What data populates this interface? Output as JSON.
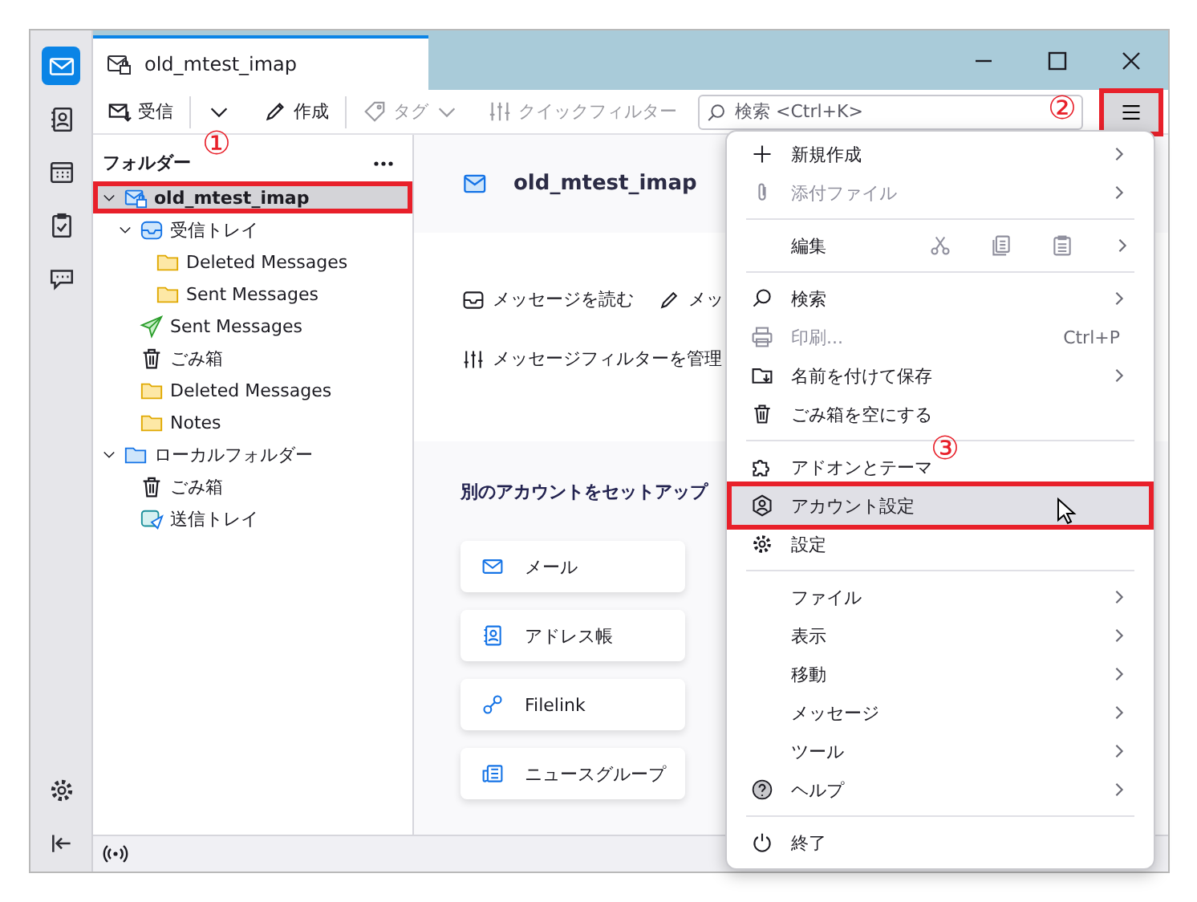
{
  "window": {
    "tab_title": "old_mtest_imap"
  },
  "spaces": [
    {
      "kind": "mail",
      "selected": true
    },
    {
      "kind": "addressbook",
      "selected": false
    },
    {
      "kind": "calendar",
      "selected": false
    },
    {
      "kind": "tasks",
      "selected": false
    },
    {
      "kind": "chat",
      "selected": false
    }
  ],
  "toolbar": {
    "get_messages": "受信",
    "write": "作成",
    "tag": {
      "label": "タグ",
      "disabled": true
    },
    "quick_filter": {
      "label": "クイックフィルター",
      "disabled": true
    },
    "search": {
      "placeholder": "検索 <Ctrl+K>"
    },
    "menu_button": {
      "highlighted": true,
      "callout": "②"
    }
  },
  "folder_pane": {
    "header": "フォルダー",
    "folders": [
      {
        "name": "old_mtest_imap",
        "kind": "account",
        "expanded": true,
        "selected": true,
        "highlighted": true,
        "callout": "①",
        "children": [
          {
            "name": "受信トレイ",
            "kind": "inbox",
            "expanded": true,
            "selected": false,
            "highlighted": false,
            "children": [
              {
                "name": "Deleted Messages",
                "kind": "folder",
                "selected": false,
                "highlighted": false
              },
              {
                "name": "Sent Messages",
                "kind": "folder",
                "selected": false,
                "highlighted": false
              }
            ]
          },
          {
            "name": "Sent Messages",
            "kind": "sent",
            "selected": false,
            "highlighted": false
          },
          {
            "name": "ごみ箱",
            "kind": "trash",
            "selected": false,
            "highlighted": false
          },
          {
            "name": "Deleted Messages",
            "kind": "folder",
            "selected": false,
            "highlighted": false
          },
          {
            "name": "Notes",
            "kind": "folder",
            "selected": false,
            "highlighted": false
          }
        ]
      },
      {
        "name": "ローカルフォルダー",
        "kind": "local",
        "expanded": true,
        "selected": false,
        "highlighted": false,
        "children": [
          {
            "name": "ごみ箱",
            "kind": "trash",
            "selected": false,
            "highlighted": false
          },
          {
            "name": "送信トレイ",
            "kind": "outbox",
            "selected": false,
            "highlighted": false
          }
        ]
      }
    ]
  },
  "account_hub": {
    "title": "old_mtest_imap",
    "actions": [
      {
        "kind": "read",
        "label": "メッセージを読む"
      },
      {
        "kind": "write",
        "label": "メッ"
      },
      {
        "kind": "filters",
        "label": "メッセージフィルターを管理"
      }
    ],
    "setup_title": "別のアカウントをセットアップ",
    "setup_options": [
      {
        "kind": "mail",
        "label": "メール"
      },
      {
        "kind": "addressbook",
        "label": "アドレス帳"
      },
      {
        "kind": "link",
        "label": "Filelink"
      },
      {
        "kind": "news",
        "label": "ニュースグループ"
      }
    ]
  },
  "app_menu": [
    {
      "kind": "new",
      "label": "新規作成",
      "submenu": true,
      "disabled": false,
      "selected": false,
      "highlighted": false
    },
    {
      "kind": "attachments",
      "label": "添付ファイル",
      "submenu": true,
      "disabled": true,
      "selected": false,
      "highlighted": false
    },
    {
      "kind": "separator"
    },
    {
      "kind": "edit",
      "label": "編集",
      "submenu": true
    },
    {
      "kind": "separator"
    },
    {
      "kind": "search",
      "label": "検索",
      "submenu": true,
      "disabled": false,
      "selected": false,
      "highlighted": false
    },
    {
      "kind": "print",
      "label": "印刷...",
      "shortcut": "Ctrl+P",
      "submenu": false,
      "disabled": true,
      "selected": false,
      "highlighted": false
    },
    {
      "kind": "save_as",
      "label": "名前を付けて保存",
      "submenu": true,
      "disabled": false,
      "selected": false,
      "highlighted": false
    },
    {
      "kind": "empty_trash",
      "label": "ごみ箱を空にする",
      "submenu": false,
      "disabled": false,
      "selected": false,
      "highlighted": false
    },
    {
      "kind": "separator"
    },
    {
      "kind": "addons",
      "label": "アドオンとテーマ",
      "submenu": false,
      "disabled": false,
      "selected": false,
      "highlighted": false
    },
    {
      "kind": "account_settings",
      "label": "アカウント設定",
      "submenu": false,
      "disabled": false,
      "selected": true,
      "highlighted": true,
      "callout": "③"
    },
    {
      "kind": "settings",
      "label": "設定",
      "submenu": false,
      "disabled": false,
      "selected": false,
      "highlighted": false
    },
    {
      "kind": "separator"
    },
    {
      "kind": "plain",
      "label": "ファイル",
      "submenu": true,
      "disabled": false,
      "selected": false,
      "highlighted": false
    },
    {
      "kind": "plain",
      "label": "表示",
      "submenu": true,
      "disabled": false,
      "selected": false,
      "highlighted": false
    },
    {
      "kind": "plain",
      "label": "移動",
      "submenu": true,
      "disabled": false,
      "selected": false,
      "highlighted": false
    },
    {
      "kind": "plain",
      "label": "メッセージ",
      "submenu": true,
      "disabled": false,
      "selected": false,
      "highlighted": false
    },
    {
      "kind": "plain",
      "label": "ツール",
      "submenu": true,
      "disabled": false,
      "selected": false,
      "highlighted": false
    },
    {
      "kind": "help",
      "label": "ヘルプ",
      "submenu": true,
      "disabled": false,
      "selected": false,
      "highlighted": false
    },
    {
      "kind": "separator"
    },
    {
      "kind": "quit",
      "label": "終了",
      "submenu": false,
      "disabled": false,
      "selected": false,
      "highlighted": false
    }
  ]
}
